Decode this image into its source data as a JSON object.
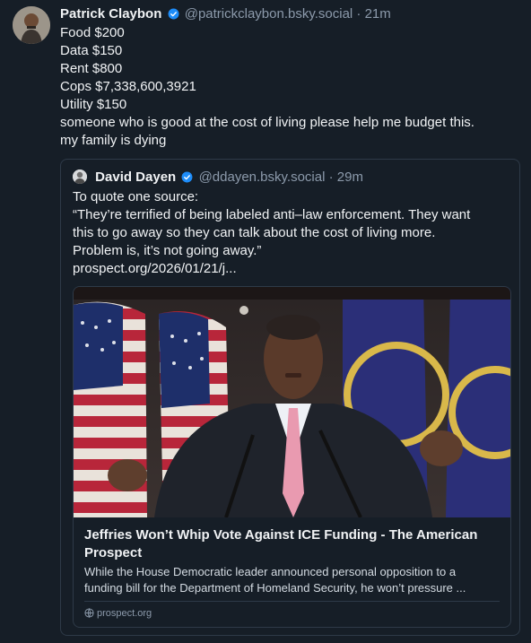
{
  "post": {
    "author_name": "Patrick Claybon",
    "handle": "@patrickclaybon.bsky.social",
    "separator": "·",
    "time": "21m",
    "lines": [
      "Food $200",
      "Data $150",
      "Rent $800",
      "Cops $7,338,600,3921",
      "Utility $150",
      "someone who is good at the cost of living please help me budget this.",
      "my family is dying"
    ]
  },
  "quote": {
    "author_name": "David Dayen",
    "handle": "@ddayen.bsky.social",
    "separator": "·",
    "time": "29m",
    "lines": [
      "To quote one source:",
      "“They’re terrified of being labeled anti–law enforcement. They want",
      "this to go away so they can talk about the cost of living more.",
      "Problem is, it’s not going away.”",
      "prospect.org/2026/01/21/j..."
    ],
    "card": {
      "title": "Jeffries Won’t Whip Vote Against ICE Funding - The American Prospect",
      "description_lines": [
        "While the House Democratic leader announced personal opposition to a",
        "funding bill for the Department of Homeland Security, he won’t pressure ..."
      ],
      "domain": "prospect.org"
    }
  },
  "colors": {
    "background": "#161e27",
    "text": "#f1f3f5",
    "muted": "#8c9aab",
    "verified": "#1d8cf8",
    "border": "#2e3a48"
  },
  "icons": {
    "verified": "verified-check-icon",
    "globe": "globe-icon"
  }
}
